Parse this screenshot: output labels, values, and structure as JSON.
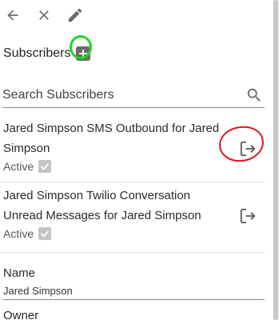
{
  "header": {
    "title": "Subscribers"
  },
  "search": {
    "placeholder": "Search Subscribers"
  },
  "subscribers": [
    {
      "title": "Jared Simpson SMS Outbound for Jared Simpson",
      "status": "Active"
    },
    {
      "title": "Jared Simpson Twilio Conversation Unread Messages for Jared Simpson",
      "status": "Active"
    }
  ],
  "fields": {
    "name_label": "Name",
    "name_value": "Jared Simpson",
    "owner_label": "Owner"
  },
  "icons": {
    "back": "arrow-left-icon",
    "close": "close-icon",
    "edit": "pencil-icon",
    "add": "plus-icon",
    "search": "search-icon",
    "unsubscribe": "exit-icon",
    "check": "check-icon"
  },
  "colors": {
    "annotation_green": "#22d41c",
    "annotation_red": "#e3141c",
    "icon_gray": "#6b6b6b"
  }
}
